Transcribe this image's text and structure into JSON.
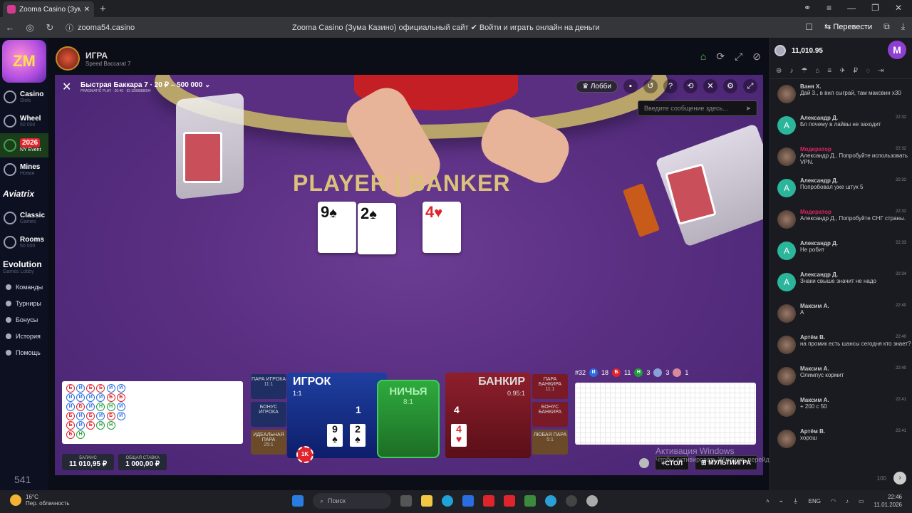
{
  "browser": {
    "tab_title": "Zooma Casino (Зума Ка",
    "url": "zooma54.casino",
    "page_title": "Zooma Casino (Зума Казино) официальный сайт ✔ Войти и играть онлайн на деньги",
    "translate": "Перевести"
  },
  "sidebar": {
    "items": [
      {
        "label": "Casino",
        "sub": "Slots"
      },
      {
        "label": "Wheel",
        "sub": "50 000"
      },
      {
        "label": "2026",
        "sub": "NY Event"
      },
      {
        "label": "Mines",
        "sub": "Новая"
      },
      {
        "label": "Aviatrix",
        "sub": ""
      },
      {
        "label": "Classic",
        "sub": "Games"
      },
      {
        "label": "Rooms",
        "sub": "50 000"
      },
      {
        "label": "Evolution",
        "sub": "Games Lobby"
      }
    ],
    "links": [
      "Команды",
      "Турниры",
      "Бонусы",
      "История",
      "Помощь"
    ],
    "counter": "541"
  },
  "game_header": {
    "title": "ИГРА",
    "subtitle": "Speed Baccarat 7"
  },
  "video": {
    "game_name": "Быстрая Баккара 7 · 20 ₽ – 500 000 ⌄",
    "provider": "PRAGMATIC PLAY · 20:46 · ID:1098888004",
    "lobby": "Лобби",
    "msg_placeholder": "Введите сообщение здесь...",
    "table_text_player": "PLAYER",
    "table_text_banker": "BANKER",
    "player_cards": [
      {
        "rank": "9",
        "suit": "♠"
      },
      {
        "rank": "2",
        "suit": "♠"
      }
    ],
    "banker_cards": [
      {
        "rank": "4",
        "suit": "♥"
      }
    ]
  },
  "bets": {
    "pair_player": "ПАРА ИГРОКА",
    "pair_player_odds": "11:1",
    "bonus_player": "БОНУС ИГРОКА",
    "perfect_pair": "ИДЕАЛЬНАЯ ПАРА",
    "perfect_pair_odds": "25:1",
    "player": "ИГРОК",
    "player_odds": "1:1",
    "player_score": "1",
    "tie": "НИЧЬЯ",
    "tie_odds": "8:1",
    "banker": "БАНКИР",
    "banker_odds": "0.95:1",
    "banker_score": "4",
    "pair_banker": "ПАРА БАНКИРА",
    "pair_banker_odds": "11:1",
    "bonus_banker": "БОНУС БАНКИРА",
    "any_pair": "ЛЮБАЯ ПАРА",
    "any_pair_odds": "5:1",
    "chip": "1K"
  },
  "balance": {
    "balance_label": "БАЛАНС",
    "balance_value": "11 010,95 ₽",
    "bet_label": "ОБЩАЯ СТАВКА",
    "bet_value": "1 000,00 ₽"
  },
  "stats": {
    "round": "#32",
    "p": "18",
    "b": "11",
    "t": "3",
    "pp": "3",
    "bp": "1"
  },
  "beads": [
    [
      "Б",
      "И",
      "И",
      "Б",
      "Б",
      "Б"
    ],
    [
      "И",
      "И",
      "Б",
      "И",
      "И",
      "Н"
    ],
    [
      "Б",
      "И",
      "И",
      "Б",
      "Б",
      ""
    ],
    [
      "Б",
      "И",
      "Н",
      "И",
      "Н",
      ""
    ],
    [
      "И",
      "Б",
      "Н",
      "Б",
      "Н",
      ""
    ],
    [
      "И",
      "Б",
      "И",
      "И",
      "",
      ""
    ]
  ],
  "controls": {
    "add_table": "+СТОЛ",
    "multigame": "МУЛЬТИИГРА"
  },
  "watermark": {
    "line1": "Активация Windows",
    "line2": "Чтобы активировать Windows, перейдите в раздел \"Параметры\"."
  },
  "chat": {
    "balance": "11,010.95",
    "avatar": "M",
    "messages": [
      {
        "name": "Ваня Х.",
        "text": "Дай 3., в вил сыграй, там максвин х30",
        "time": "",
        "av": "img",
        "mod": false
      },
      {
        "name": "Александр Д.",
        "text": "Бл почему в лайвы не заходит",
        "time": "22:32",
        "av": "A",
        "mod": false
      },
      {
        "name": "Модератор",
        "text": "Александр Д., Попробуйте использовать VPN.",
        "time": "22:32",
        "av": "img",
        "mod": true
      },
      {
        "name": "Александр Д.",
        "text": "Попробовал уже штук 5",
        "time": "22:32",
        "av": "A",
        "mod": false
      },
      {
        "name": "Модератор",
        "text": "Александр Д., Попробуйте СНГ страны.",
        "time": "22:32",
        "av": "img",
        "mod": true
      },
      {
        "name": "Александр Д.",
        "text": "Не робит",
        "time": "22:33",
        "av": "A",
        "mod": false
      },
      {
        "name": "Александр Д.",
        "text": "Знаки свыше значит не надо",
        "time": "22:34",
        "av": "A",
        "mod": false
      },
      {
        "name": "Максим А.",
        "text": "А",
        "time": "22:40",
        "av": "img",
        "mod": false
      },
      {
        "name": "Артём В.",
        "text": "на промик есть шансы сегодня кто знает?",
        "time": "22:40",
        "av": "img",
        "mod": false
      },
      {
        "name": "Максим А.",
        "text": "Олимпус кормит",
        "time": "22:40",
        "av": "img",
        "mod": false
      },
      {
        "name": "Максим А.",
        "text": "+ 200 с 50",
        "time": "22:41",
        "av": "img",
        "mod": false
      },
      {
        "name": "Артём В.",
        "text": "хорош",
        "time": "22:41",
        "av": "img",
        "mod": false
      }
    ]
  },
  "taskbar": {
    "temp": "16°C",
    "weather": "Пер. облачность",
    "search": "Поиск",
    "lang": "ENG",
    "time": "22:46",
    "date": "11.01.2026"
  },
  "colors": {
    "felt": "#5a2f82",
    "player_blue": "#1f3fa0",
    "tie_green": "#2eaa3e",
    "banker_red": "#8e1f2c",
    "accent_red": "#e0242c"
  }
}
